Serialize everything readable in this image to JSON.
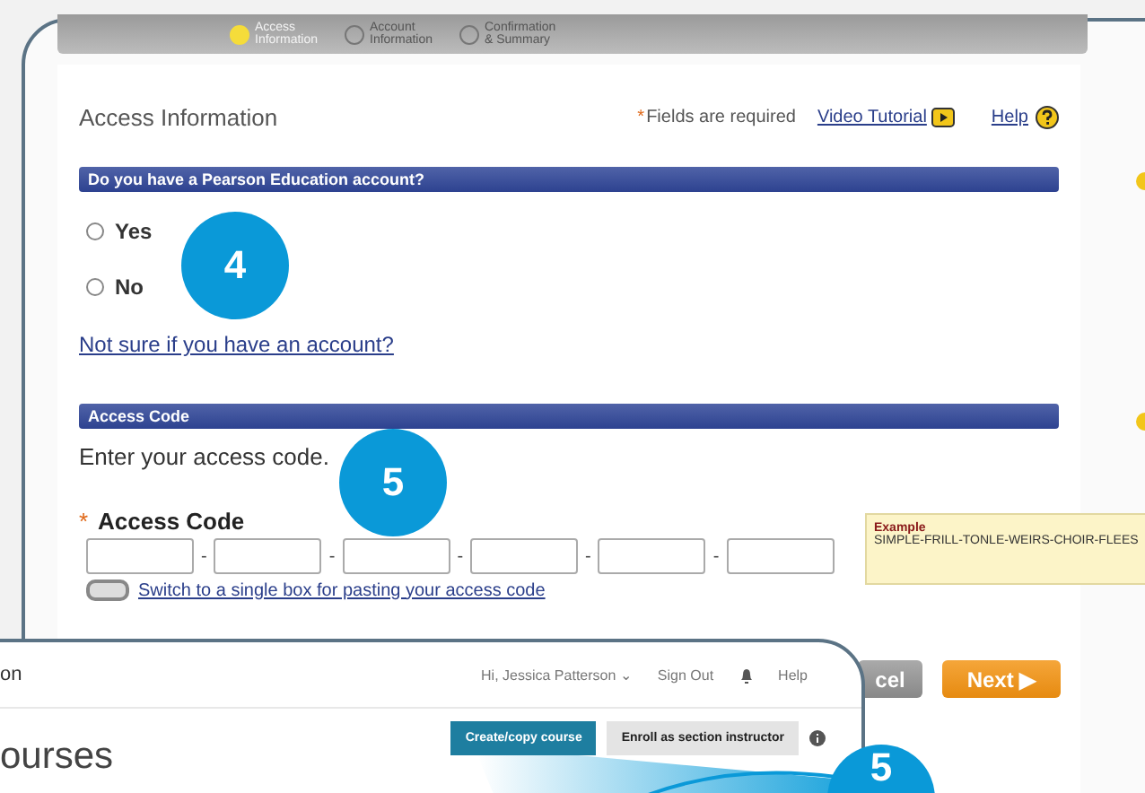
{
  "steps": [
    {
      "label": "Access Information",
      "selected": true
    },
    {
      "label": "Account Information",
      "selected": false
    },
    {
      "label": "Confirmation & Summary",
      "selected": false
    }
  ],
  "header": {
    "title": "Access Information",
    "required_mark": "*",
    "required_note": "Fields are required",
    "video_link": "Video Tutorial",
    "help_link": "Help"
  },
  "account_section": {
    "title": "Do you have a Pearson Education account?",
    "options": [
      {
        "label": "Yes",
        "selected": false
      },
      {
        "label": "No",
        "selected": false
      }
    ],
    "link": "Not sure if you have an account?"
  },
  "code_section": {
    "title": "Access Code",
    "instruction": "Enter your access code.",
    "field_mark": "*",
    "field_label": "Access Code",
    "separators": [
      "-",
      "-",
      "-",
      "-",
      "-"
    ],
    "switch_on": false,
    "switch_link": "Switch to a single box for pasting your access code",
    "example_title": "Example",
    "example_code": "SIMPLE-FRILL-TONLE-WEIRS-CHOIR-FLEES"
  },
  "buttons": [
    {
      "label": "cel",
      "kind": "secondary"
    },
    {
      "label": "Next ▶",
      "kind": "primary"
    }
  ],
  "overlay": {
    "brand": "on",
    "user_menu": "Hi, Jessica Patterson ⌄",
    "sign_out": "Sign Out",
    "help": "Help",
    "heading": "ourses",
    "create_button": "Create/copy course",
    "enroll_button": "Enroll as section instructor"
  },
  "callouts": [
    {
      "number": "4"
    },
    {
      "number": "5"
    },
    {
      "number": "5"
    }
  ]
}
